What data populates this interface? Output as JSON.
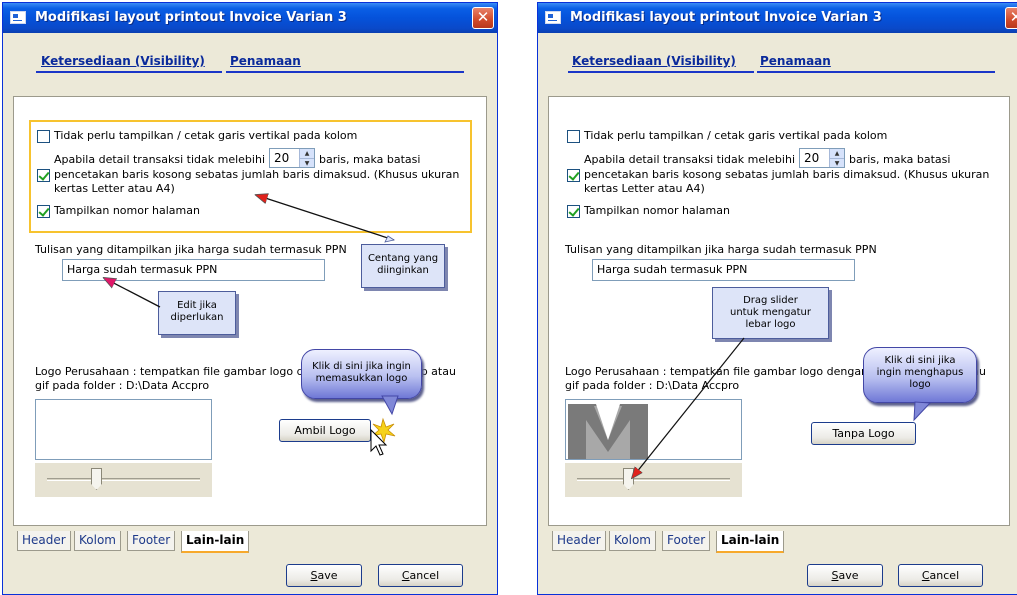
{
  "left": {
    "title": "Modifikasi layout printout Invoice Varian 3",
    "close_glyph": "✕",
    "tabs": [
      "Ketersediaan (Visibility)",
      "Penamaan"
    ],
    "opt_vertical": "Tidak perlu tampilkan / cetak garis vertikal pada kolom",
    "opt_detail_pre": "Apabila detail transaksi tidak melebihi",
    "spin_value": "20",
    "opt_detail_post": "baris, maka batasi",
    "opt_detail_line2": "pencetakan baris kosong sebatas jumlah baris dimaksud. (Khusus ukuran",
    "opt_detail_line3": "kertas Letter atau A4)",
    "opt_pagenum": "Tampilkan nomor halaman",
    "ppn_label": "Tulisan yang ditampilkan jika harga sudah termasuk PPN",
    "ppn_value": "Harga sudah termasuk PPN",
    "logo_label_1": "Logo Perusahaan : tempatkan file gambar logo dengan nama logo.bmp atau",
    "logo_label_2": "gif pada folder : D:\\Data Accpro",
    "logo_button": "Ambil Logo",
    "bottom_tabs": [
      "Header",
      "Kolom",
      "Footer",
      "Lain-lain"
    ],
    "save": "Save",
    "save_acc": "S",
    "save_rest": "ave",
    "cancel_acc": "C",
    "cancel_rest": "ancel",
    "callout_centang": "Centang yang\ndiinginkan",
    "callout_edit": "Edit jika\ndiperlukan",
    "bubble_ambil": "Klik di sini jika ingin\nmemasukkan logo"
  },
  "right": {
    "title": "Modifikasi layout printout Invoice Varian 3",
    "close_glyph": "✕",
    "tabs": [
      "Ketersediaan (Visibility)",
      "Penamaan"
    ],
    "opt_vertical": "Tidak perlu tampilkan / cetak garis vertikal pada kolom",
    "opt_detail_pre": "Apabila detail transaksi tidak melebihi",
    "spin_value": "20",
    "opt_detail_post": "baris, maka batasi",
    "opt_detail_line2": "pencetakan baris kosong sebatas jumlah baris dimaksud. (Khusus ukuran",
    "opt_detail_line3": "kertas Letter atau A4)",
    "opt_pagenum": "Tampilkan nomor halaman",
    "ppn_label": "Tulisan yang ditampilkan jika harga sudah termasuk PPN",
    "ppn_value": "Harga sudah termasuk PPN",
    "logo_label_1": "Logo Perusahaan : tempatkan file gambar logo dengan nama logo.bmp atau",
    "logo_label_2": "gif pada folder : D:\\Data Accpro",
    "logo_button": "Tanpa Logo",
    "bottom_tabs": [
      "Header",
      "Kolom",
      "Footer",
      "Lain-lain"
    ],
    "save_acc": "S",
    "save_rest": "ave",
    "cancel_acc": "C",
    "cancel_rest": "ancel",
    "callout_drag": "Drag slider\nuntuk mengatur\nlebar logo",
    "bubble_hapus": "Klik di sini jika\ningin menghapus\nlogo"
  },
  "colors": {
    "titlebar": "#0552da",
    "highlight_frame": "#f7c32e",
    "tab_underline": "#1a36c8",
    "active_tab_accent": "#f7a92b",
    "arrow_red": "#e0221c",
    "arrow_magenta": "#e0186a",
    "check_green": "#21a121"
  },
  "icons": [
    "window-app-icon",
    "close-icon",
    "checkbox-icon",
    "spin-up-icon",
    "spin-down-icon",
    "mouse-cursor-icon",
    "click-sparkle-icon",
    "logo-m-icon"
  ]
}
